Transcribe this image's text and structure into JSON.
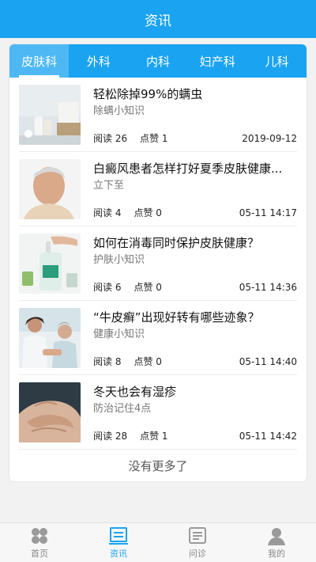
{
  "header": {
    "title": "资讯"
  },
  "tabs": [
    {
      "label": "皮肤科",
      "active": true
    },
    {
      "label": "外科",
      "active": false
    },
    {
      "label": "内科",
      "active": false
    },
    {
      "label": "妇产科",
      "active": false
    },
    {
      "label": "儿科",
      "active": false
    }
  ],
  "articles": [
    {
      "title": "轻松除掉99%的螨虫",
      "category": "除螨小知识",
      "reads_label": "阅读 26",
      "likes_label": "点赞 1",
      "date": "2019-09-12"
    },
    {
      "title": "白癜风患者怎样打好夏季皮肤健康...",
      "category": "立下至",
      "reads_label": "阅读 4",
      "likes_label": "点赞 0",
      "date": "05-11 14:17"
    },
    {
      "title": "如何在消毒同时保护皮肤健康？",
      "category": "护肤小知识",
      "reads_label": "阅读 6",
      "likes_label": "点赞 0",
      "date": "05-11 14:36"
    },
    {
      "title": "“牛皮癣”出现好转有哪些迹象？",
      "category": "健康小知识",
      "reads_label": "阅读 8",
      "likes_label": "点赞 0",
      "date": "05-11 14:40"
    },
    {
      "title": "冬天也会有湿疹",
      "category": "防治记住4点",
      "reads_label": "阅读 28",
      "likes_label": "点赞 1",
      "date": "05-11 14:42"
    }
  ],
  "list_footer": "没有更多了",
  "bottom_nav": [
    {
      "label": "首页",
      "icon": "home-grid-icon",
      "active": false
    },
    {
      "label": "资讯",
      "icon": "news-icon",
      "active": true
    },
    {
      "label": "问诊",
      "icon": "consult-icon",
      "active": false
    },
    {
      "label": "我的",
      "icon": "user-icon",
      "active": false
    }
  ],
  "colors": {
    "primary": "#1aa3f0",
    "tab_active_bg": "#4db8f4",
    "inactive_nav": "#888888"
  }
}
